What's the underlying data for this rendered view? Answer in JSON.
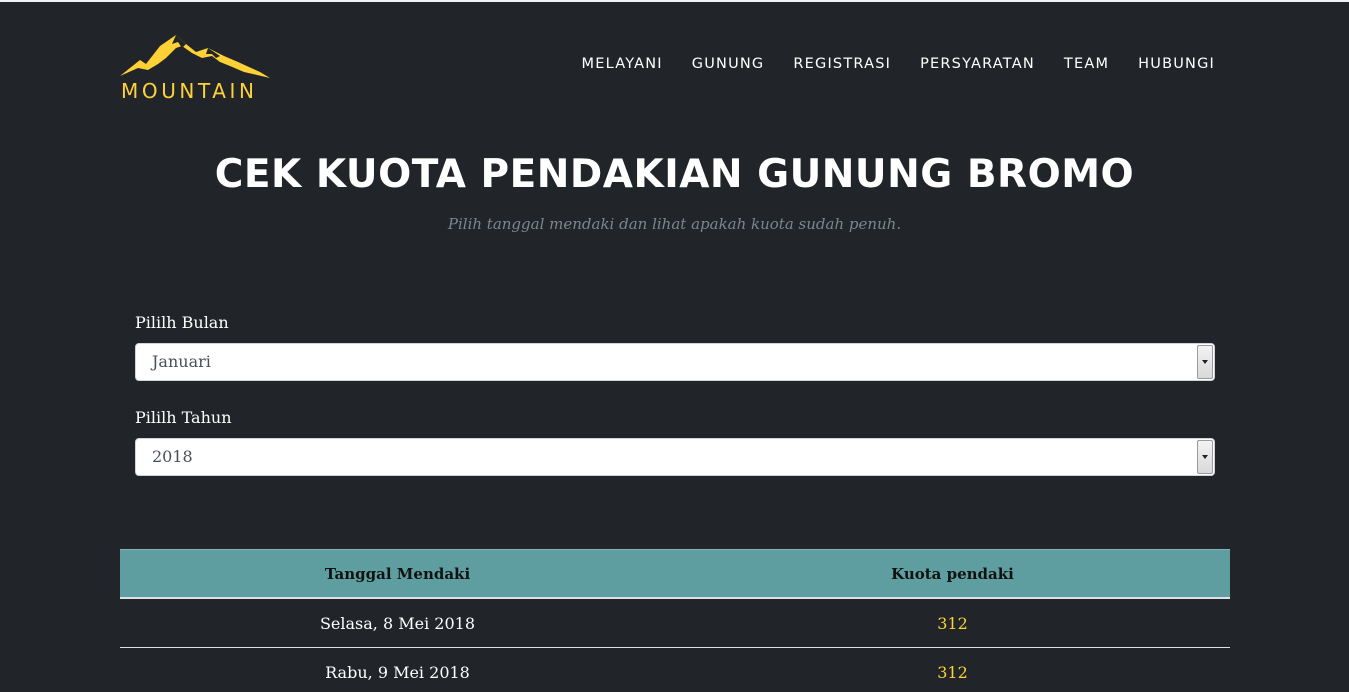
{
  "brand": {
    "name": "MOUNTAIN",
    "accent": "#fed136"
  },
  "nav": {
    "items": [
      "MELAYANI",
      "GUNUNG",
      "REGISTRASI",
      "PERSYARATAN",
      "TEAM",
      "HUBUNGI"
    ]
  },
  "header": {
    "title": "CEK KUOTA PENDAKIAN GUNUNG BROMO",
    "subtitle": "Pilih tanggal mendaki dan lihat apakah kuota sudah penuh."
  },
  "form": {
    "month_label": "Pililh Bulan",
    "month_value": "Januari",
    "year_label": "Pililh Tahun",
    "year_value": "2018"
  },
  "table": {
    "headers": [
      "Tanggal Mendaki",
      "Kuota pendaki"
    ],
    "rows": [
      {
        "date": "Selasa, 8 Mei 2018",
        "quota": "312"
      },
      {
        "date": "Rabu, 9 Mei 2018",
        "quota": "312"
      }
    ],
    "header_color": "#5f9ea0"
  },
  "icons": {
    "logo": "mountain-logo-icon",
    "select_arrow": "chevron-down-icon"
  }
}
